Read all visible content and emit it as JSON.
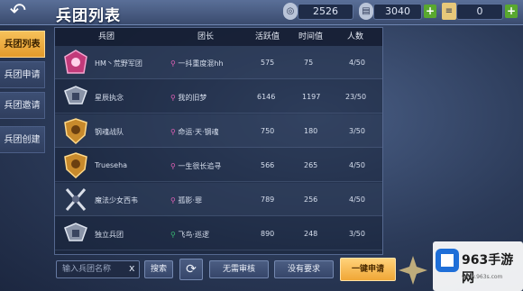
{
  "header": {
    "back_label": "↶",
    "title": "兵团列表",
    "resources": [
      {
        "icon": "silver-coin-icon",
        "value": "2526"
      },
      {
        "icon": "ticket-icon",
        "value": "3040"
      },
      {
        "icon": "scroll-icon",
        "value": "0"
      }
    ],
    "plus_label": "+"
  },
  "sidebar": {
    "tabs": [
      {
        "label": "兵团列表",
        "active": true
      },
      {
        "label": "兵团申请",
        "active": false
      },
      {
        "label": "兵团邀请",
        "active": false
      },
      {
        "label": "兵团创建",
        "active": false
      }
    ]
  },
  "table": {
    "columns": [
      "兵团",
      "团长",
      "活跃值",
      "时间值",
      "人数"
    ],
    "rows": [
      {
        "emblem": "pink-crest-icon",
        "name": "HM丶荒野军团",
        "leader": "一抖重度混hh",
        "active": "575",
        "time": "75",
        "members": "4/50"
      },
      {
        "emblem": "silver-wing-icon",
        "name": "星辰执念",
        "leader": "我的旧梦",
        "active": "6146",
        "time": "1197",
        "members": "23/50"
      },
      {
        "emblem": "gold-shield-icon",
        "name": "钢魂战队",
        "leader": "命运·天·钢魂",
        "active": "750",
        "time": "180",
        "members": "3/50"
      },
      {
        "emblem": "gold-shield-icon",
        "name": "Trueseha",
        "leader": "一生很长追寻",
        "active": "566",
        "time": "265",
        "members": "4/50"
      },
      {
        "emblem": "cross-sword-icon",
        "name": "魔法少女西韦",
        "leader": "孤影·罪",
        "active": "789",
        "time": "256",
        "members": "4/50"
      },
      {
        "emblem": "silver-wing-icon",
        "name": "独立兵团",
        "leader": "飞鸟·巡逻",
        "active": "890",
        "time": "248",
        "members": "3/50"
      }
    ]
  },
  "footer": {
    "search_placeholder": "输入兵团名称",
    "clear_label": "x",
    "search_label": "搜索",
    "refresh_icon": "refresh-icon",
    "btn_quick_join": "无需审核",
    "btn_no_request": "没有要求",
    "btn_apply": "一键申请"
  },
  "watermark": {
    "brand": "963手游网",
    "url": "www.963s.com"
  },
  "colors": {
    "accent": "#f0a737",
    "pin_pink": "#e061b6",
    "pin_green": "#38b872"
  }
}
